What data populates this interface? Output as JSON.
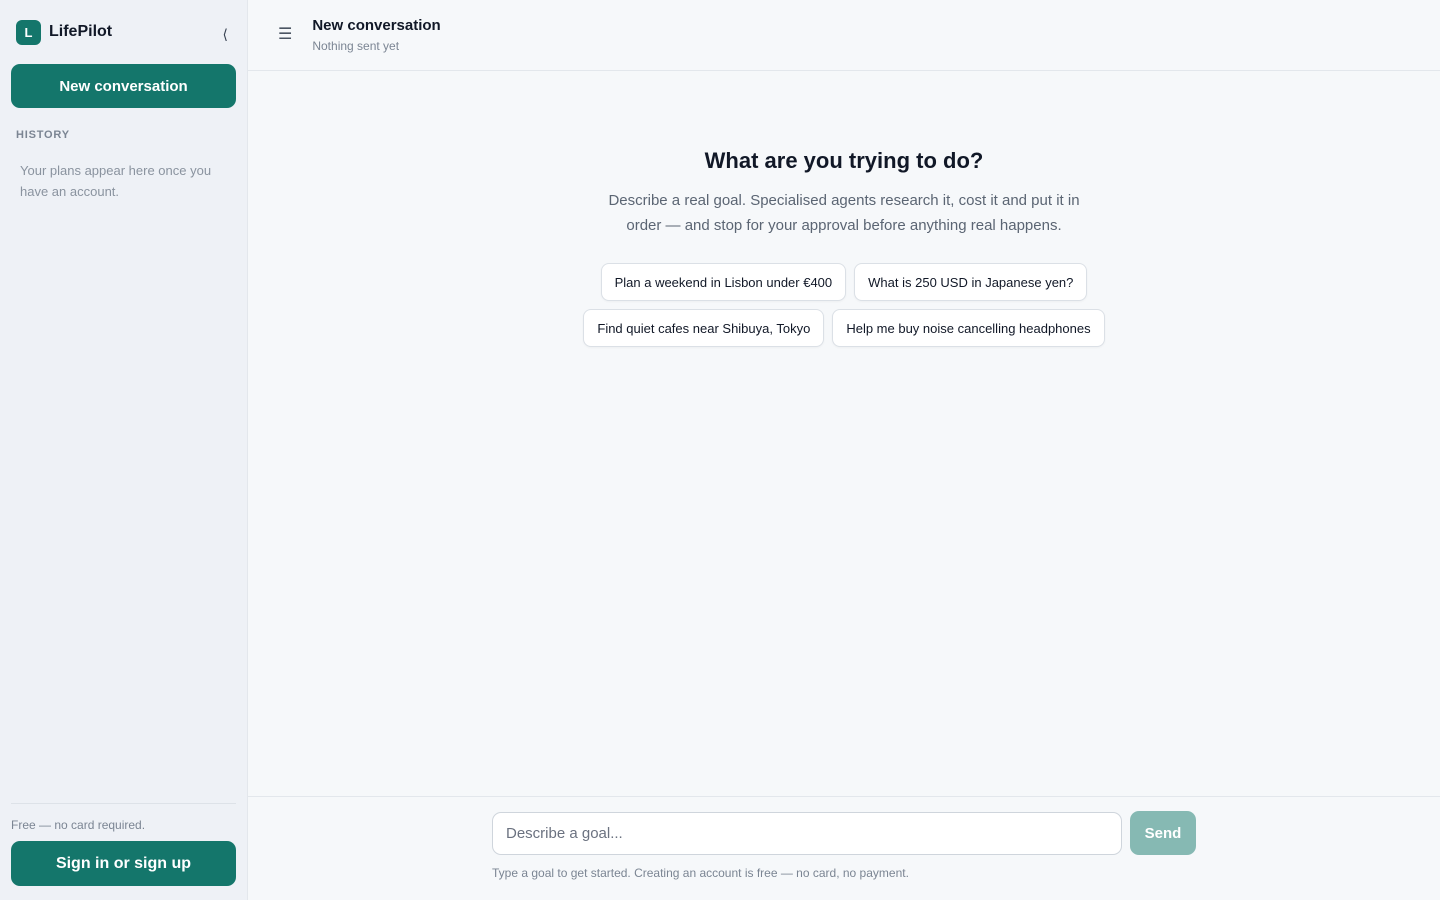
{
  "sidebar": {
    "brand": {
      "logo_letter": "L",
      "name": "LifePilot"
    },
    "collapse_glyph": "⟨",
    "new_conversation_label": "New conversation",
    "history_title": "HISTORY",
    "history_empty": "Your plans appear here once you have an account.",
    "footer": {
      "note": "Free — no card required.",
      "signin_label": "Sign in or sign up"
    }
  },
  "header": {
    "menu_glyph": "☰",
    "title": "New conversation",
    "subtitle": "Nothing sent yet"
  },
  "hero": {
    "title": "What are you trying to do?",
    "description": "Describe a real goal. Specialised agents research it, cost it and put it in order — and stop for your approval before anything real happens.",
    "suggestions": [
      "Plan a weekend in Lisbon under €400",
      "What is 250 USD in Japanese yen?",
      "Find quiet cafes near Shibuya, Tokyo",
      "Help me buy noise cancelling headphones"
    ]
  },
  "composer": {
    "placeholder": "Describe a goal...",
    "send_label": "Send",
    "note": "Type a goal to get started. Creating an account is free — no card, no payment."
  },
  "colors": {
    "accent": "#14766b",
    "send_disabled": "#86b9b3"
  }
}
